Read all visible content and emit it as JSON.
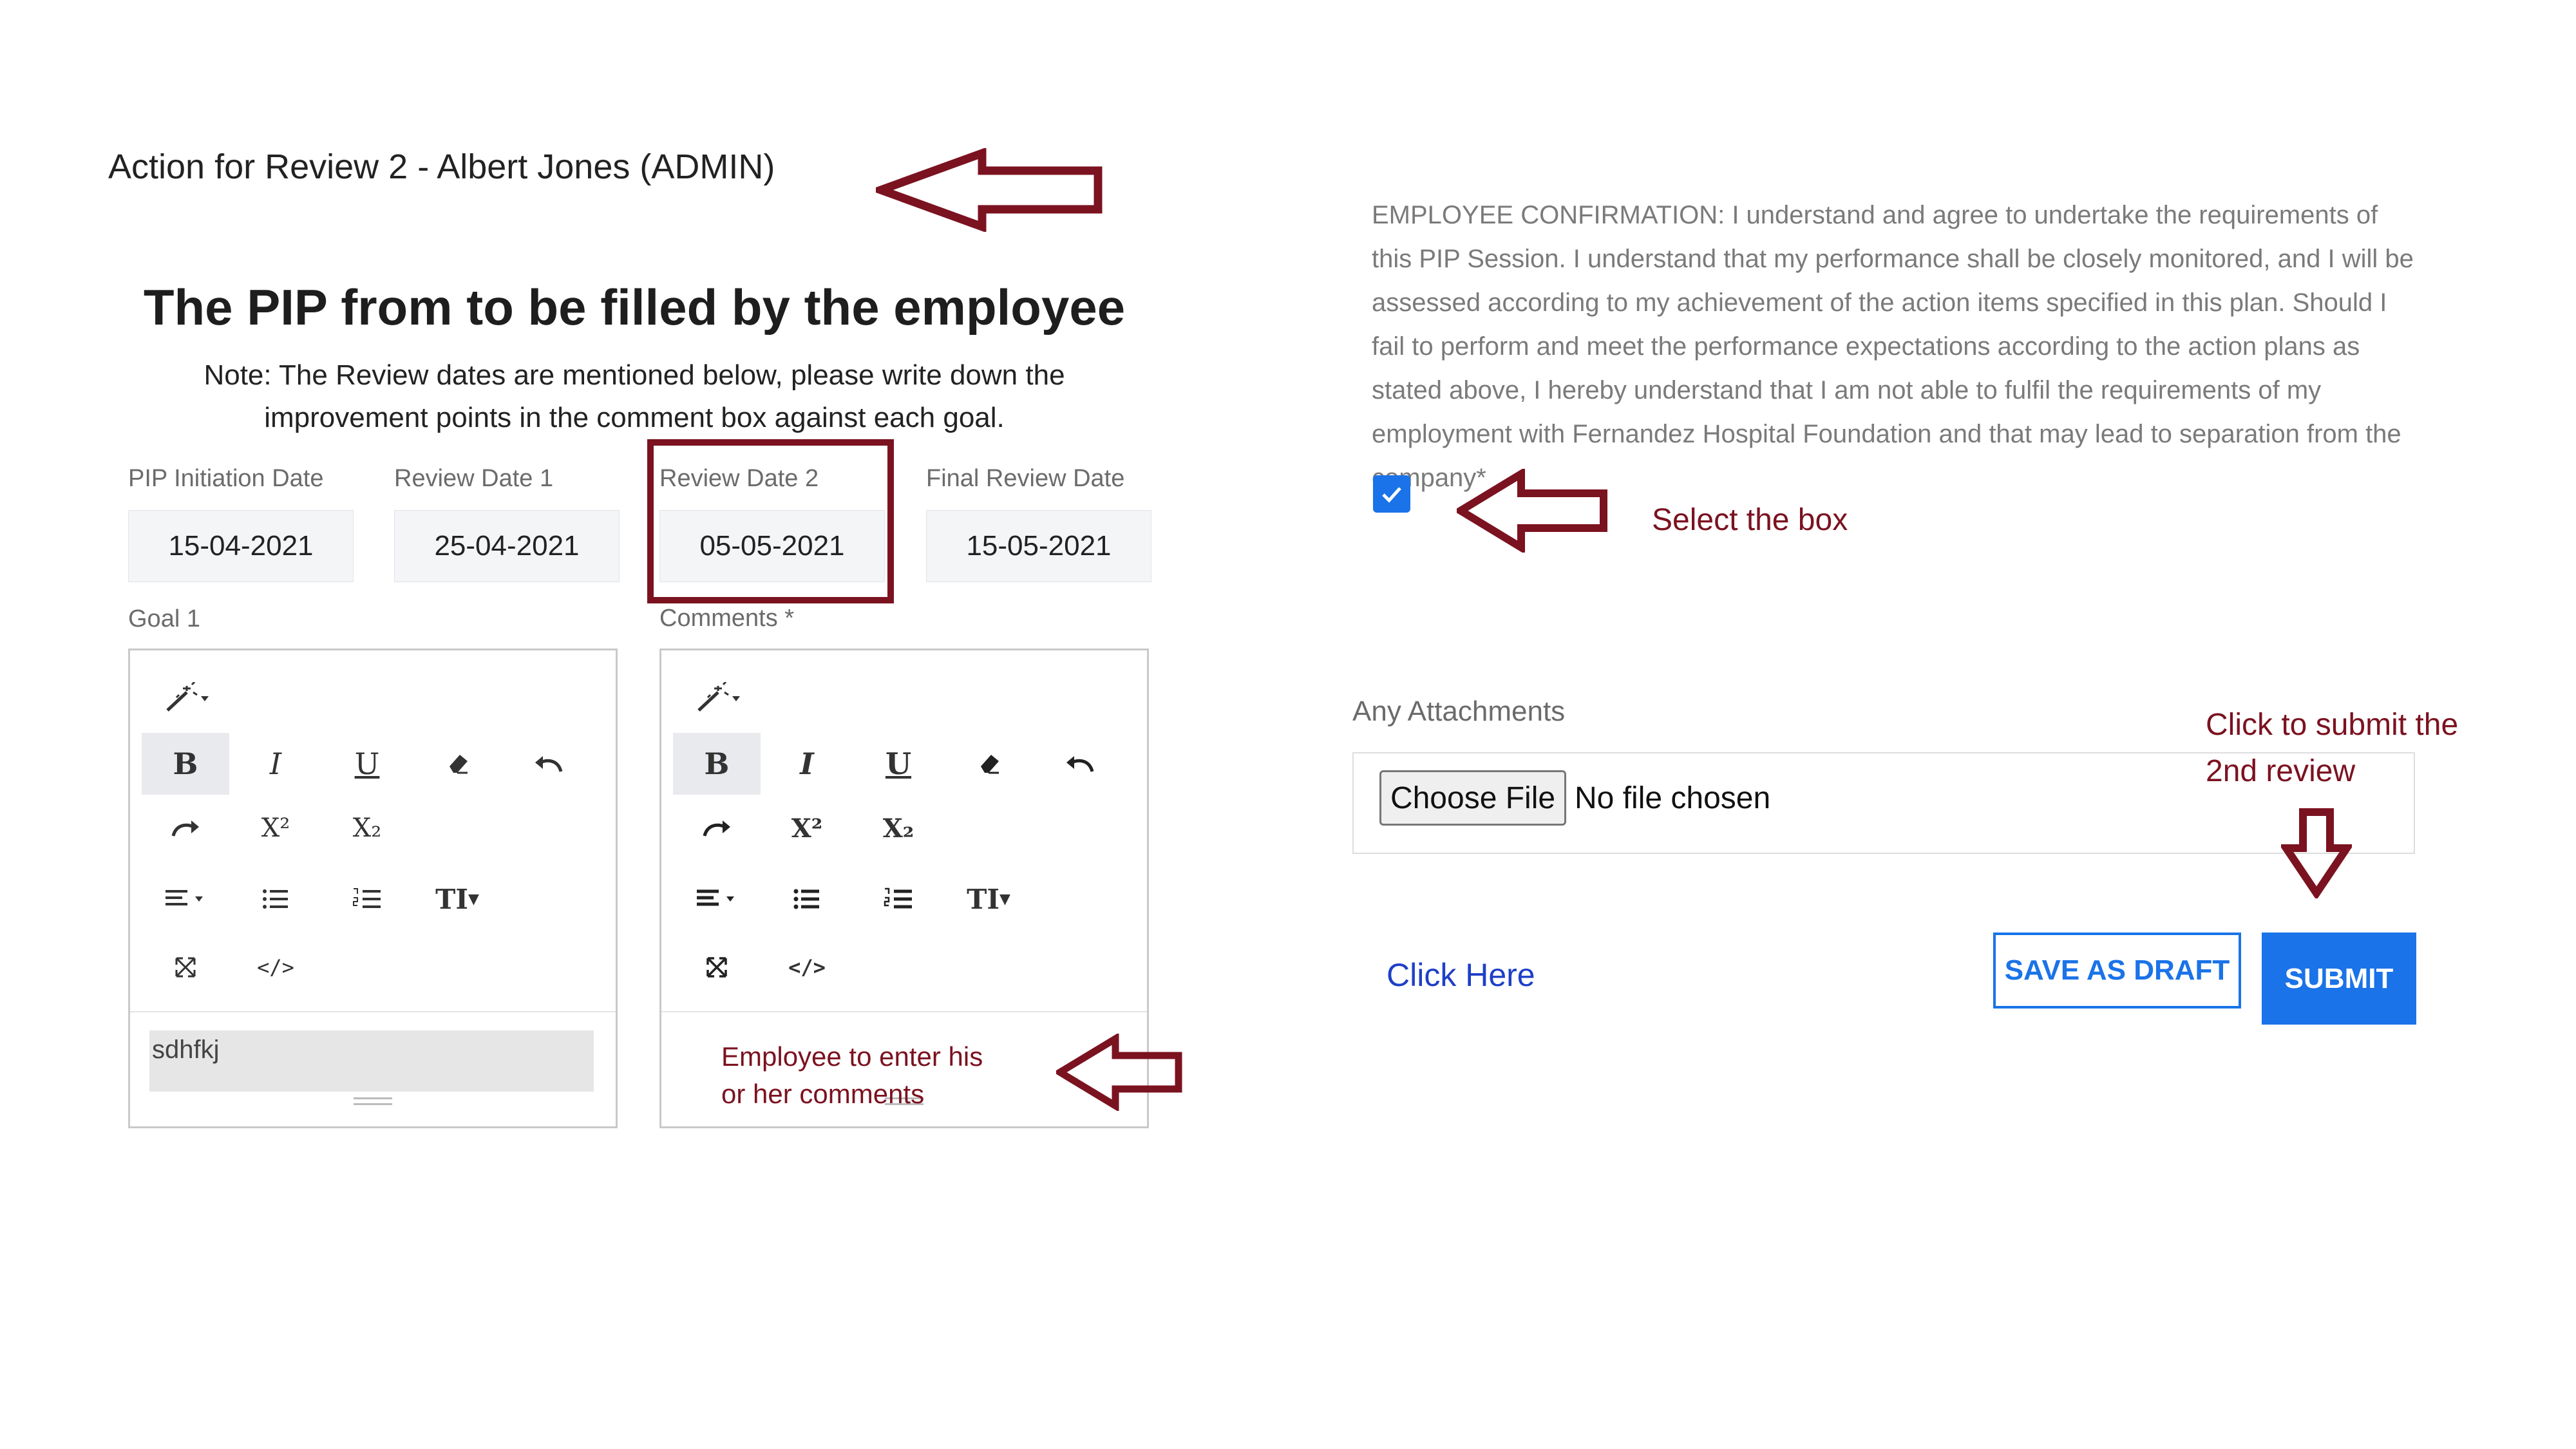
{
  "review_heading": "Action for Review 2 - Albert Jones (ADMIN)",
  "form": {
    "title": "The PIP from to be filled by the employee",
    "note_line1": "Note: The Review dates are mentioned below, please write down the",
    "note_line2": "improvement points in the comment box against each goal.",
    "dates": [
      {
        "label": "PIP Initiation Date",
        "value": "15-04-2021"
      },
      {
        "label": "Review Date 1",
        "value": "25-04-2021"
      },
      {
        "label": "Review Date 2",
        "value": "05-05-2021"
      },
      {
        "label": "Final Review Date",
        "value": "15-05-2021"
      }
    ],
    "goal_label": "Goal 1",
    "comments_label": "Comments *",
    "goal_text": "sdhfkj"
  },
  "toolbar_icons": {
    "magic": "magic-wand-icon",
    "bold": "B",
    "italic": "I",
    "underline": "U",
    "eraser": "eraser-icon",
    "undo": "undo-icon",
    "redo": "redo-icon",
    "superscript": "X²",
    "subscript": "X₂",
    "align": "align-icon",
    "bullets": "bulleted-list-icon",
    "numbers": "numbered-list-icon",
    "text_size": "TI",
    "fullscreen": "fullscreen-icon",
    "code": "</>"
  },
  "confirmation": {
    "text": "EMPLOYEE CONFIRMATION: I understand and agree to undertake the requirements of this PIP Session. I understand that my performance shall be closely monitored, and I will be assessed according to my achievement of the action items specified in this plan. Should I fail to perform and meet the performance expectations according to the action plans as stated above, I hereby understand that I am not able to fulfil the requirements of my employment with Fernandez Hospital Foundation and that may lead to separation from the company*",
    "checked": true
  },
  "attachments": {
    "label": "Any Attachments",
    "button": "Choose File",
    "status": "No file chosen"
  },
  "actions": {
    "click_here": "Click Here",
    "save_draft": "SAVE AS DRAFT",
    "submit": "SUBMIT"
  },
  "annotations": {
    "select_box": "Select the box",
    "submit_line1": "Click to submit the",
    "submit_line2": "2nd review",
    "employee_line1": "Employee to enter his",
    "employee_line2": "or her comments"
  },
  "colors": {
    "annotation": "#7b1220",
    "accent": "#1a73e8",
    "link": "#1e3fc7"
  }
}
